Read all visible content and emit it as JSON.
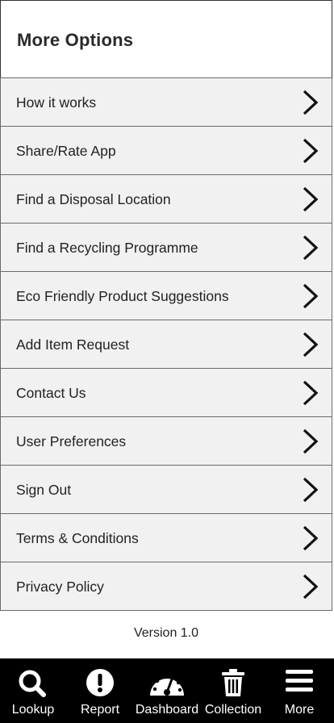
{
  "header": {
    "title": "More Options"
  },
  "menu": {
    "items": [
      {
        "label": "How it works",
        "name": "how-it-works"
      },
      {
        "label": "Share/Rate App",
        "name": "share-rate-app"
      },
      {
        "label": "Find a Disposal Location",
        "name": "find-disposal-location"
      },
      {
        "label": "Find a Recycling Programme",
        "name": "find-recycling-programme"
      },
      {
        "label": "Eco Friendly Product Suggestions",
        "name": "eco-friendly-product-suggestions"
      },
      {
        "label": "Add Item Request",
        "name": "add-item-request"
      },
      {
        "label": "Contact Us",
        "name": "contact-us"
      },
      {
        "label": "User Preferences",
        "name": "user-preferences"
      },
      {
        "label": "Sign Out",
        "name": "sign-out"
      },
      {
        "label": "Terms & Conditions",
        "name": "terms-conditions"
      },
      {
        "label": "Privacy Policy",
        "name": "privacy-policy"
      }
    ],
    "chevron_icon": "chevron-right-icon"
  },
  "footer": {
    "version": "Version 1.0"
  },
  "tabbar": {
    "background": "#000000",
    "tabs": [
      {
        "label": "Lookup",
        "icon": "search-icon"
      },
      {
        "label": "Report",
        "icon": "alert-icon"
      },
      {
        "label": "Dashboard",
        "icon": "dashboard-gauge-icon"
      },
      {
        "label": "Collection",
        "icon": "trash-icon"
      },
      {
        "label": "More",
        "icon": "menu-icon"
      }
    ]
  }
}
